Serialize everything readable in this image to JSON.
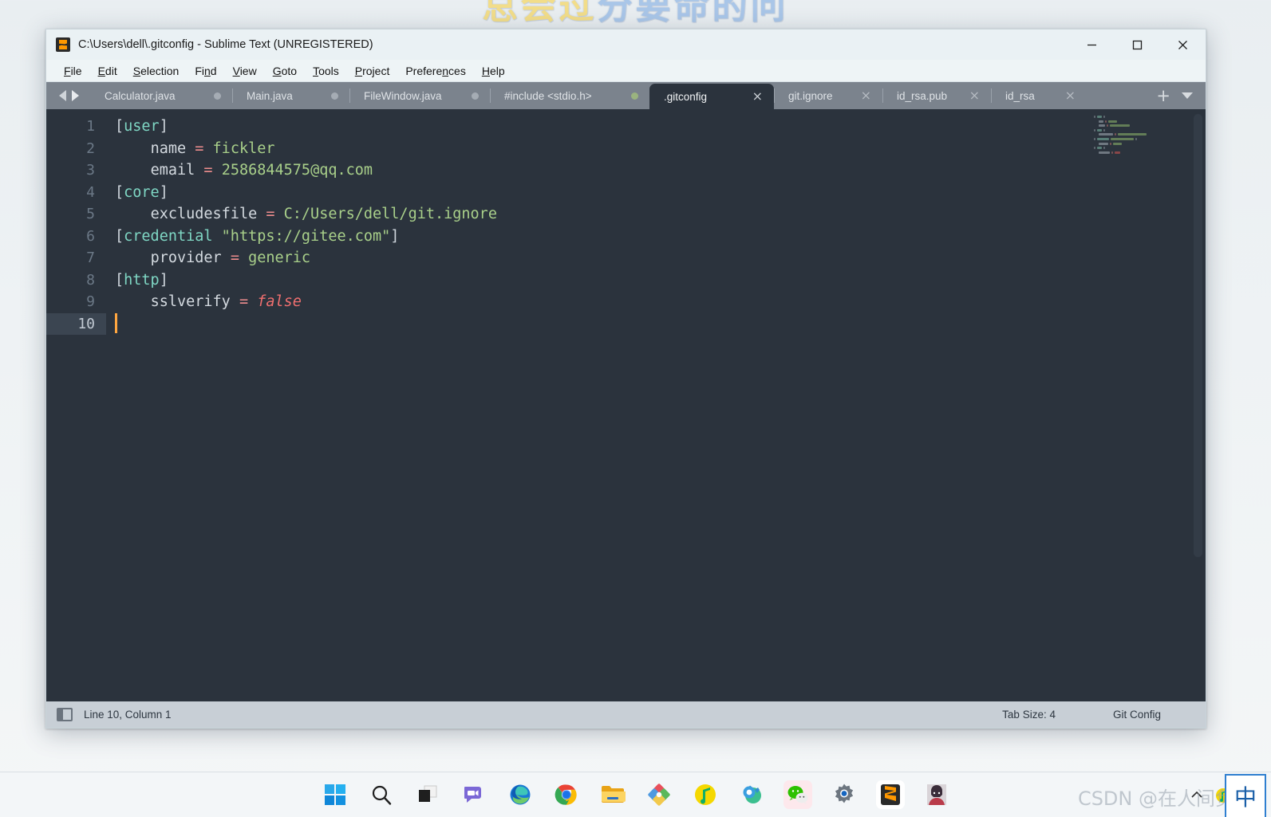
{
  "desktop": {
    "wallpaper_text_part1": "总会过",
    "wallpaper_text_part2": "分要命的问",
    "watermark": "CSDN @在人间负债"
  },
  "window": {
    "title": "C:\\Users\\dell\\.gitconfig - Sublime Text (UNREGISTERED)",
    "app_icon": "sublime-text-icon",
    "controls": {
      "minimize": "minimize-icon",
      "maximize": "maximize-icon",
      "close": "close-icon"
    }
  },
  "menu": {
    "items": [
      {
        "pre": "",
        "mnemonic": "F",
        "post": "ile"
      },
      {
        "pre": "",
        "mnemonic": "E",
        "post": "dit"
      },
      {
        "pre": "",
        "mnemonic": "S",
        "post": "election"
      },
      {
        "pre": "Fi",
        "mnemonic": "n",
        "post": "d"
      },
      {
        "pre": "",
        "mnemonic": "V",
        "post": "iew"
      },
      {
        "pre": "",
        "mnemonic": "G",
        "post": "oto"
      },
      {
        "pre": "",
        "mnemonic": "T",
        "post": "ools"
      },
      {
        "pre": "",
        "mnemonic": "P",
        "post": "roject"
      },
      {
        "pre": "Prefere",
        "mnemonic": "n",
        "post": "ces"
      },
      {
        "pre": "",
        "mnemonic": "H",
        "post": "elp"
      }
    ]
  },
  "tabs": {
    "nav_prev": "arrow-left-icon",
    "nav_next": "arrow-right-icon",
    "add_label": "+",
    "menu_icon": "chevron-down-icon",
    "items": [
      {
        "label": "Calculator.java",
        "active": false,
        "state": "modified",
        "state_color": "#a5acb4"
      },
      {
        "label": "Main.java",
        "active": false,
        "state": "modified",
        "state_color": "#a5acb4"
      },
      {
        "label": "FileWindow.java",
        "active": false,
        "state": "modified",
        "state_color": "#a5acb4"
      },
      {
        "label": "#include <stdio.h>",
        "active": false,
        "state": "modified",
        "state_color": "#9ab37f"
      },
      {
        "label": ".gitconfig",
        "active": true,
        "state": "close",
        "close_label": "×"
      },
      {
        "label": "git.ignore",
        "active": false,
        "state": "close",
        "close_label": "×"
      },
      {
        "label": "id_rsa.pub",
        "active": false,
        "state": "close",
        "close_label": "×"
      },
      {
        "label": "id_rsa",
        "active": false,
        "state": "close",
        "close_label": "×"
      }
    ]
  },
  "editor": {
    "line_numbers": [
      "1",
      "2",
      "3",
      "4",
      "5",
      "6",
      "7",
      "8",
      "9",
      "10"
    ],
    "current_line_index": 9,
    "lines": [
      {
        "n": 1,
        "raw": "[user]"
      },
      {
        "n": 2,
        "raw": "    name = fickler"
      },
      {
        "n": 3,
        "raw": "    email = 2586844575@qq.com"
      },
      {
        "n": 4,
        "raw": "[core]"
      },
      {
        "n": 5,
        "raw": "    excludesfile = C:/Users/dell/git.ignore"
      },
      {
        "n": 6,
        "raw": "[credential \"https://gitee.com\"]"
      },
      {
        "n": 7,
        "raw": "    provider = generic"
      },
      {
        "n": 8,
        "raw": "[http]"
      },
      {
        "n": 9,
        "raw": "    sslverify = false"
      },
      {
        "n": 10,
        "raw": ""
      }
    ],
    "full_text": "[user]\n    name = fickler\n    email = 2586844575@qq.com\n[core]\n    excludesfile = C:/Users/dell/git.ignore\n[credential \"https://gitee.com\"]\n    provider = generic\n[http]\n    sslverify = false\n"
  },
  "status_bar": {
    "sidebar_icon": "sidebar-toggle-icon",
    "position": "Line 10, Column 1",
    "tab_size": "Tab Size: 4",
    "syntax": "Git Config"
  },
  "taskbar": {
    "icons": [
      {
        "name": "windows-start-icon"
      },
      {
        "name": "search-icon"
      },
      {
        "name": "task-view-icon"
      },
      {
        "name": "microsoft-teams-icon"
      },
      {
        "name": "microsoft-edge-icon"
      },
      {
        "name": "google-chrome-icon"
      },
      {
        "name": "file-explorer-icon"
      },
      {
        "name": "wps-office-icon"
      },
      {
        "name": "qq-music-icon"
      },
      {
        "name": "pycharm-tool-icon"
      },
      {
        "name": "wechat-icon"
      },
      {
        "name": "settings-gear-icon"
      },
      {
        "name": "sublime-text-icon"
      },
      {
        "name": "user-avatar-icon"
      }
    ],
    "tray": {
      "overflow": "chevron-up-icon",
      "items": [
        "qq-music-tray-icon",
        "csdn-tray-icon"
      ],
      "ime": "中"
    }
  },
  "colors": {
    "editor_bg": "#2b333d",
    "tab_bar_bg": "#7b838d",
    "active_tab_bg": "#2b333d",
    "status_bar_bg": "#c8cfd6",
    "cursor": "#ffa640",
    "section": "#7fd7c4",
    "value": "#a9d08a",
    "operator": "#ef8e8e",
    "boolean": "#ef6f6f"
  }
}
